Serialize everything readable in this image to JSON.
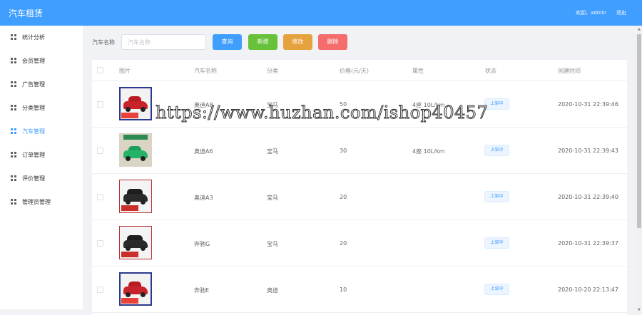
{
  "header": {
    "title": "汽车租赁",
    "welcome": "欢迎，admin",
    "logout": "退出"
  },
  "sidebar": {
    "items": [
      {
        "label": "统计分析"
      },
      {
        "label": "会员管理"
      },
      {
        "label": "广告管理"
      },
      {
        "label": "分类管理"
      },
      {
        "label": "汽车管理",
        "active": true
      },
      {
        "label": "订单管理"
      },
      {
        "label": "评价管理"
      },
      {
        "label": "管理员管理"
      }
    ]
  },
  "filter": {
    "label": "汽车名称",
    "placeholder": "汽车名称",
    "buttons": {
      "search": "查询",
      "add": "新增",
      "edit": "修改",
      "delete": "删除"
    }
  },
  "colors": {
    "primary": "#409eff",
    "success": "#67c23a",
    "warning": "#e6a23c",
    "danger": "#f56c6c"
  },
  "table": {
    "headers": {
      "image": "图片",
      "name": "汽车名称",
      "category": "分类",
      "price": "价格(元/天)",
      "attr": "属性",
      "status": "状态",
      "created": "创建时间"
    },
    "rows": [
      {
        "name": "奥迪A8",
        "category": "宝马",
        "price": "50",
        "attr": "4座 10L/km",
        "status": "上架中",
        "created": "2020-10-31 22:39:46",
        "image": "red-suv-icon"
      },
      {
        "name": "奥迪A6",
        "category": "宝马",
        "price": "30",
        "attr": "4座 10L/km",
        "status": "上架中",
        "created": "2020-10-31 22:39:43",
        "image": "green-sports-car-icon"
      },
      {
        "name": "奥迪A3",
        "category": "宝马",
        "price": "20",
        "attr": "",
        "status": "上架中",
        "created": "2020-10-31 22:39:40",
        "image": "black-suv-icon"
      },
      {
        "name": "奔驰G",
        "category": "宝马",
        "price": "20",
        "attr": "",
        "status": "上架中",
        "created": "2020-10-31 22:39:37",
        "image": "black-suv-icon"
      },
      {
        "name": "奔驰E",
        "category": "奥迪",
        "price": "10",
        "attr": "",
        "status": "上架中",
        "created": "2020-10-20 22:13:47",
        "image": "red-suv-icon"
      }
    ]
  },
  "watermark": "https://www.huzhan.com/ishop40457"
}
